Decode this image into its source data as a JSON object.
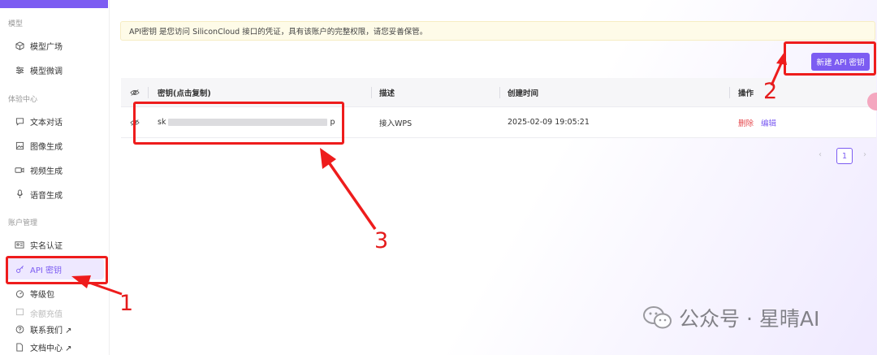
{
  "sidebar": {
    "sections": [
      {
        "label": "模型",
        "items": [
          {
            "label": "模型广场",
            "icon": "cube-icon"
          },
          {
            "label": "模型微调",
            "icon": "tune-icon"
          }
        ]
      },
      {
        "label": "体验中心",
        "items": [
          {
            "label": "文本对话",
            "icon": "chat-icon"
          },
          {
            "label": "图像生成",
            "icon": "image-icon"
          },
          {
            "label": "视频生成",
            "icon": "video-icon"
          },
          {
            "label": "语音生成",
            "icon": "mic-icon"
          }
        ]
      },
      {
        "label": "账户管理",
        "items": [
          {
            "label": "实名认证",
            "icon": "id-card-icon"
          },
          {
            "label": "API 密钥",
            "icon": "key-icon",
            "active": true
          },
          {
            "label": "等级包",
            "icon": "gauge-icon"
          },
          {
            "label": "余额充值",
            "icon": "wallet-icon"
          }
        ]
      }
    ],
    "footer": [
      {
        "label": "联系我们 ↗",
        "icon": "help-circle-icon"
      },
      {
        "label": "文档中心 ↗",
        "icon": "document-icon"
      }
    ]
  },
  "notice": "API密钥 是您访问 SiliconCloud 接口的凭证，具有该账户的完整权限，请您妥善保管。",
  "toolbar": {
    "new_key_label": "新建 API 密钥"
  },
  "table": {
    "headers": {
      "key": "密钥(点击复制)",
      "desc": "描述",
      "created": "创建时间",
      "actions": "操作"
    },
    "rows": [
      {
        "key_prefix": "sk",
        "key_suffix": "p",
        "desc": "接入WPS",
        "created": "2025-02-09 19:05:21",
        "delete": "删除",
        "edit": "编辑"
      }
    ]
  },
  "pagination": {
    "current": "1",
    "prev": "‹",
    "next": "›"
  },
  "annotations": {
    "label_1": "1",
    "label_2": "2",
    "label_3": "3",
    "color": "#ee1c1c"
  },
  "watermark": {
    "text": "公众号 · 星晴AI"
  },
  "colors": {
    "accent": "#7c5cf2",
    "danger": "#e5484d",
    "notice_bg": "#fefbe8"
  }
}
